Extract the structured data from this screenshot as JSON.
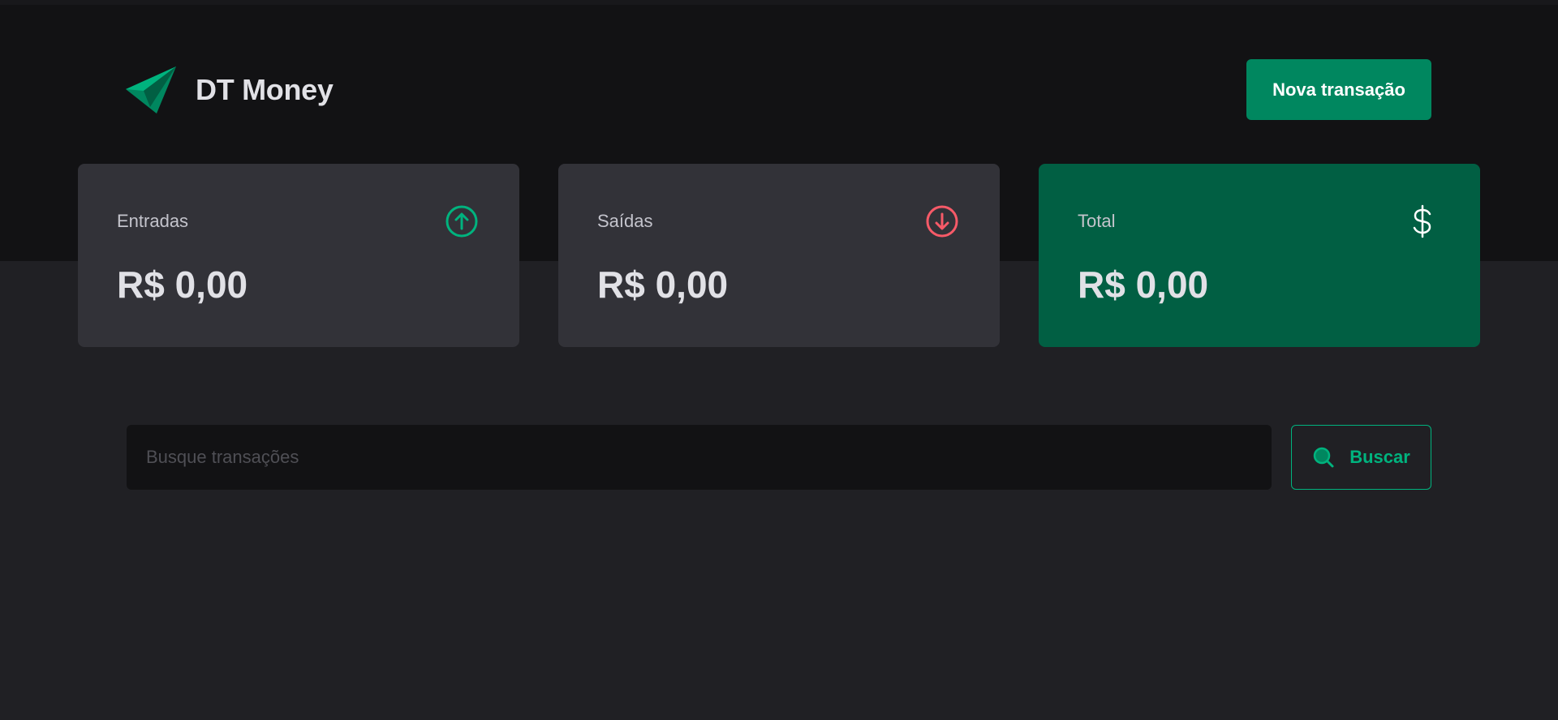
{
  "header": {
    "app_name": "DT Money",
    "new_transaction_label": "Nova transação"
  },
  "summary": {
    "income": {
      "label": "Entradas",
      "value": "R$ 0,00",
      "icon": "arrow-circle-up-icon"
    },
    "outcome": {
      "label": "Saídas",
      "value": "R$ 0,00",
      "icon": "arrow-circle-down-icon"
    },
    "total": {
      "label": "Total",
      "value": "R$ 0,00",
      "icon": "currency-dollar-icon"
    }
  },
  "search": {
    "placeholder": "Busque transações",
    "value": "",
    "button_label": "Buscar",
    "button_icon": "magnifying-glass-icon"
  },
  "colors": {
    "background": "#202024",
    "header_background": "#121214",
    "card": "#323238",
    "total_card": "#015f43",
    "brand_green": "#00875f",
    "accent_green": "#00b37e",
    "danger_red": "#f75a68"
  }
}
